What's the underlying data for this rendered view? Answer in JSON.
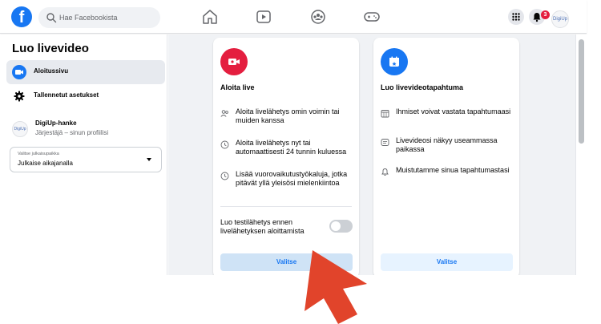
{
  "topbar": {
    "logo_letter": "f",
    "search_placeholder": "Hae Facebookista",
    "nav_icons": [
      "home-icon",
      "watch-icon",
      "groups-icon",
      "gaming-icon"
    ],
    "menu_icon": "grid-menu-icon",
    "notifications_icon": "bell-icon",
    "notifications_count": "3",
    "profile_avatar_text": "DigiUp"
  },
  "sidebar": {
    "title": "Luo livevideo",
    "items": [
      {
        "label": "Aloitussivu",
        "icon": "live-video-icon",
        "active": true
      },
      {
        "label": "Tallennetut asetukset",
        "icon": "gear-icon",
        "active": false
      }
    ],
    "profile": {
      "avatar_text": "DigiUp",
      "name": "DigiUp-hanke",
      "subtitle": "Järjestäjä – sinun profiilisi"
    },
    "post_location": {
      "label": "Valitse julkaisupaikka",
      "value": "Julkaise aikajanalla"
    }
  },
  "cards": {
    "go_live": {
      "icon": "camera-live-icon",
      "icon_color": "#e41e3f",
      "title": "Aloita live",
      "features": [
        {
          "icon": "people-icon",
          "text": "Aloita livelähetys omin voimin tai muiden kanssa"
        },
        {
          "icon": "clock-icon",
          "text": "Aloita livelähetys nyt tai automaattisesti 24 tunnin kuluessa"
        },
        {
          "icon": "clock-icon",
          "text": "Lisää vuorovaikutustyökaluja, jotka pitävät yllä yleisösi mielenkiintoa"
        }
      ],
      "toggle_label": "Luo testilähetys ennen livelähetyksen aloittamista",
      "toggle_on": false,
      "button_label": "Valitse"
    },
    "live_event": {
      "icon": "calendar-icon",
      "icon_color": "#1877f2",
      "title": "Luo livevideotapahtuma",
      "features": [
        {
          "icon": "calendar-grid-icon",
          "text": "Ihmiset voivat vastata tapahtumaasi"
        },
        {
          "icon": "message-icon",
          "text": "Livevideosi näkyy useammassa paikassa"
        },
        {
          "icon": "bell-outline-icon",
          "text": "Muistutamme sinua tapahtumastasi"
        }
      ],
      "button_label": "Valitse"
    }
  },
  "colors": {
    "brand": "#1877f2",
    "live_red": "#e41e3f",
    "cursor_red": "#e1442b",
    "background": "#f0f2f5"
  }
}
